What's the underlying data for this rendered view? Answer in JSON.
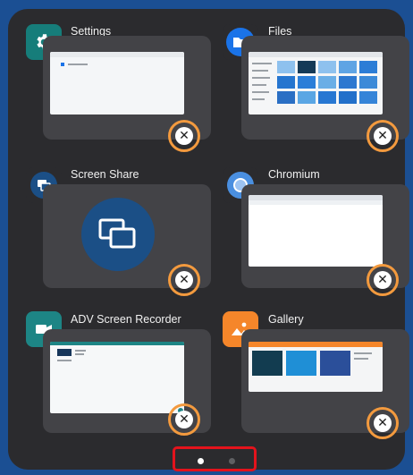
{
  "apps": [
    {
      "title": "Settings",
      "icon": "gear-icon",
      "icon_color": "#167d7a"
    },
    {
      "title": "Files",
      "icon": "folder-icon",
      "icon_color": "#1a73e8"
    },
    {
      "title": "Screen Share",
      "icon": "screen-share-icon",
      "icon_color": "#1b4f86"
    },
    {
      "title": "Chromium",
      "icon": "chromium-icon",
      "icon_color": "#4a8fe0"
    },
    {
      "title": "ADV Screen Recorder",
      "icon": "video-camera-icon",
      "icon_color": "#1d8585"
    },
    {
      "title": "Gallery",
      "icon": "image-icon",
      "icon_color": "#f5862a"
    }
  ],
  "close_icon_glyph": "✕",
  "pagination": {
    "pages": 2,
    "current": 1
  },
  "colors": {
    "highlight_ring": "#f39a3e",
    "pagination_box": "#e3131c",
    "background": "#1b4f93"
  }
}
